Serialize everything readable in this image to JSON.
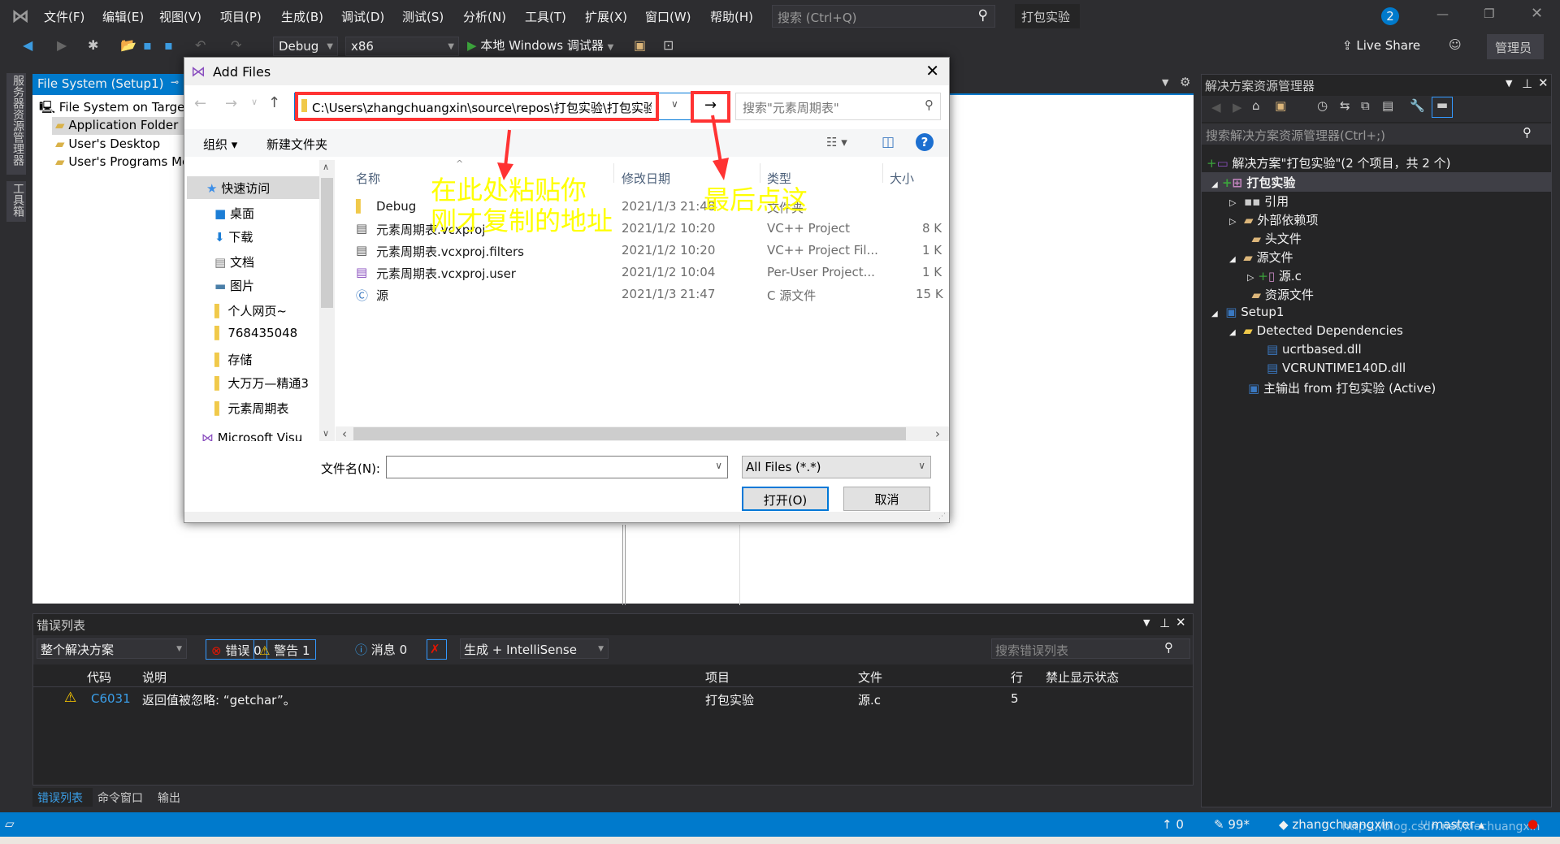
{
  "menubar": {
    "items": [
      "文件(F)",
      "编辑(E)",
      "视图(V)",
      "项目(P)",
      "生成(B)",
      "调试(D)",
      "测试(S)",
      "分析(N)",
      "工具(T)",
      "扩展(X)",
      "窗口(W)",
      "帮助(H)"
    ],
    "search_placeholder": "搜索 (Ctrl+Q)",
    "solution_name": "打包实验",
    "notification_count": "2"
  },
  "toolbar": {
    "config": "Debug",
    "platform": "x86",
    "run_label": "本地 Windows 调试器",
    "live_share": "Live Share",
    "admin": "管理员"
  },
  "side_tabs": [
    "服务器资源管理器",
    "工具箱"
  ],
  "filesystem": {
    "tab": "File System (Setup1)",
    "root": "File System on Target",
    "items": [
      "Application Folder",
      "User's Desktop",
      "User's Programs Me"
    ]
  },
  "dialog": {
    "title": "Add Files",
    "address": "C:\\Users\\zhangchuangxin\\source\\repos\\打包实验\\打包实验",
    "search_placeholder": "搜索\"元素周期表\"",
    "organize": "组织 ▾",
    "new_folder": "新建文件夹",
    "nav": [
      "快速访问",
      "桌面",
      "下载",
      "文档",
      "图片",
      "个人网页~",
      "768435048",
      "存储",
      "大万万—精通3",
      "元素周期表",
      "Microsoft Visu"
    ],
    "columns": [
      "名称",
      "修改日期",
      "类型",
      "大小"
    ],
    "files": [
      {
        "name": "Debug",
        "date": "2021/1/3 21:48",
        "type": "文件夹",
        "size": "",
        "icon": "folder-icon"
      },
      {
        "name": "元素周期表.vcxproj",
        "date": "2021/1/2 10:20",
        "type": "VC++ Project",
        "size": "8 K",
        "icon": "vcxproj-icon"
      },
      {
        "name": "元素周期表.vcxproj.filters",
        "date": "2021/1/2 10:20",
        "type": "VC++ Project Fil...",
        "size": "1 K",
        "icon": "filters-icon"
      },
      {
        "name": "元素周期表.vcxproj.user",
        "date": "2021/1/2 10:04",
        "type": "Per-User Project...",
        "size": "1 K",
        "icon": "user-file-icon"
      },
      {
        "name": "源",
        "date": "2021/1/3 21:47",
        "type": "C 源文件",
        "size": "15 K",
        "icon": "c-file-icon"
      }
    ],
    "filename_label": "文件名(N):",
    "filename_value": "",
    "filter": "All Files (*.*)",
    "open": "打开(O)",
    "cancel": "取消"
  },
  "annotations": {
    "paste_line1": "在此处粘贴你",
    "paste_line2": "刚才复制的地址",
    "click_last": "最后点这",
    "color": "#ffff00",
    "box_color": "#ff3333"
  },
  "solution_explorer": {
    "title": "解决方案资源管理器",
    "search_placeholder": "搜索解决方案资源管理器(Ctrl+;)",
    "solution": "解决方案\"打包实验\"(2 个项目，共 2 个)",
    "project": "打包实验",
    "nodes": [
      "引用",
      "外部依赖项",
      "头文件",
      "源文件",
      "源.c",
      "资源文件"
    ],
    "setup": "Setup1",
    "detected": "Detected Dependencies",
    "dlls": [
      "ucrtbased.dll",
      "VCRUNTIME140D.dll"
    ],
    "primary_output": "主输出 from 打包实验 (Active)"
  },
  "error_list": {
    "title": "错误列表",
    "scope": "整个解决方案",
    "errors": "错误 0",
    "warnings": "警告 1",
    "messages": "消息 0",
    "source": "生成 + IntelliSense",
    "search_placeholder": "搜索错误列表",
    "columns": [
      "代码",
      "说明",
      "项目",
      "文件",
      "行",
      "禁止显示状态"
    ],
    "rows": [
      {
        "code": "C6031",
        "desc": "返回值被忽略: “getchar”。",
        "project": "打包实验",
        "file": "源.c",
        "line": "5",
        "state": ""
      }
    ],
    "bottom_tabs": [
      "错误列表",
      "命令窗口",
      "输出"
    ]
  },
  "statusbar": {
    "up": "0",
    "pencil": "99*",
    "user": "zhangchuangxin",
    "branch": "master",
    "watermark": "https://blog.csdn.net/xiechuangxin"
  },
  "colors": {
    "accent": "#007acc",
    "ide_bg": "#2d2d30",
    "panel_bg": "#252526"
  }
}
